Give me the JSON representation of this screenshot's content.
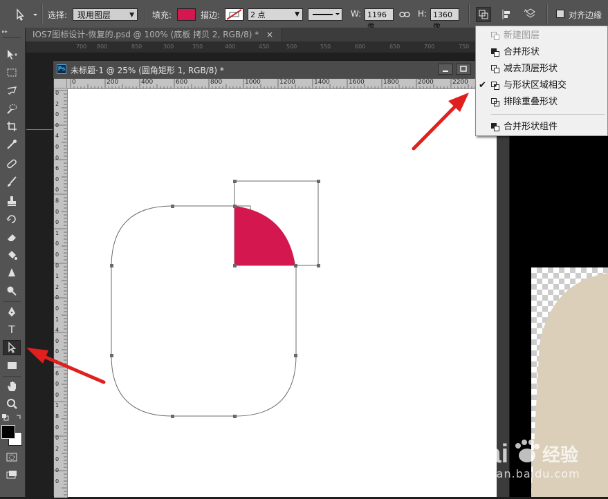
{
  "options_bar": {
    "select_label": "选择:",
    "select_value": "现用图层",
    "fill_label": "填充:",
    "fill_color": "#d4174f",
    "stroke_label": "描边:",
    "stroke_width": "2 点",
    "width_label": "W:",
    "width_value": "1196 像",
    "height_label": "H:",
    "height_value": "1360 像",
    "align_edges_label": "对齐边缘"
  },
  "doc_tab": {
    "title": "IOS7图标设计-恢复的.psd @ 100% (底板 拷贝 2, RGB/8) *",
    "close": "×"
  },
  "background_ruler_labels": [
    "700",
    "800",
    "850",
    "300",
    "350",
    "400",
    "450",
    "500",
    "550",
    "600",
    "650",
    "700",
    "750"
  ],
  "doc_window": {
    "ps_icon": "Ps",
    "title": "未标题-1 @ 25% (圆角矩形 1, RGB/8) *",
    "ruler_h": [
      "0",
      "200",
      "400",
      "600",
      "800",
      "1000",
      "1200",
      "1400",
      "1600",
      "1800",
      "2000",
      "2200"
    ],
    "ruler_v": [
      "0",
      "2",
      "0",
      "0",
      "4",
      "0",
      "0",
      "6",
      "0",
      "0",
      "8",
      "0",
      "0",
      "1",
      "0",
      "0",
      "0",
      "1",
      "2",
      "0",
      "0",
      "1",
      "4",
      "0",
      "0",
      "1",
      "6",
      "0",
      "0",
      "1",
      "8",
      "0",
      "0",
      "2",
      "0",
      "0",
      "0"
    ]
  },
  "path_menu": {
    "items": [
      {
        "label": "新建图层",
        "disabled": true,
        "checked": false,
        "icon": "new-layer-icon"
      },
      {
        "label": "合并形状",
        "disabled": false,
        "checked": false,
        "icon": "combine-shapes-icon"
      },
      {
        "label": "减去顶层形状",
        "disabled": false,
        "checked": false,
        "icon": "subtract-front-shape-icon"
      },
      {
        "label": "与形状区域相交",
        "disabled": false,
        "checked": true,
        "icon": "intersect-shape-areas-icon"
      },
      {
        "label": "排除重叠形状",
        "disabled": false,
        "checked": false,
        "icon": "exclude-overlapping-shapes-icon"
      },
      {
        "label": "合并形状组件",
        "disabled": false,
        "checked": false,
        "icon": "merge-shape-components-icon"
      }
    ],
    "check_mark": "✔"
  },
  "tools": [
    "move-tool",
    "marquee-tool",
    "lasso-tool",
    "quick-selection-tool",
    "crop-tool",
    "eyedropper-tool",
    "healing-brush-tool",
    "brush-tool",
    "clone-stamp-tool",
    "history-brush-tool",
    "eraser-tool",
    "paint-bucket-tool",
    "blur-tool",
    "dodge-tool",
    "pen-tool",
    "type-tool",
    "path-selection-tool",
    "rectangle-tool",
    "hand-tool",
    "zoom-tool"
  ],
  "tool_glyphs": {
    "type": "T"
  },
  "colors": {
    "accent_red": "#e0201f",
    "shape_fill": "#d4174f",
    "ui_dark": "#535353",
    "right_shape": "#dccfba"
  },
  "watermark": {
    "logo": "Bai",
    "logo_tail": "经验",
    "url": "jingyan.baidu.com"
  }
}
